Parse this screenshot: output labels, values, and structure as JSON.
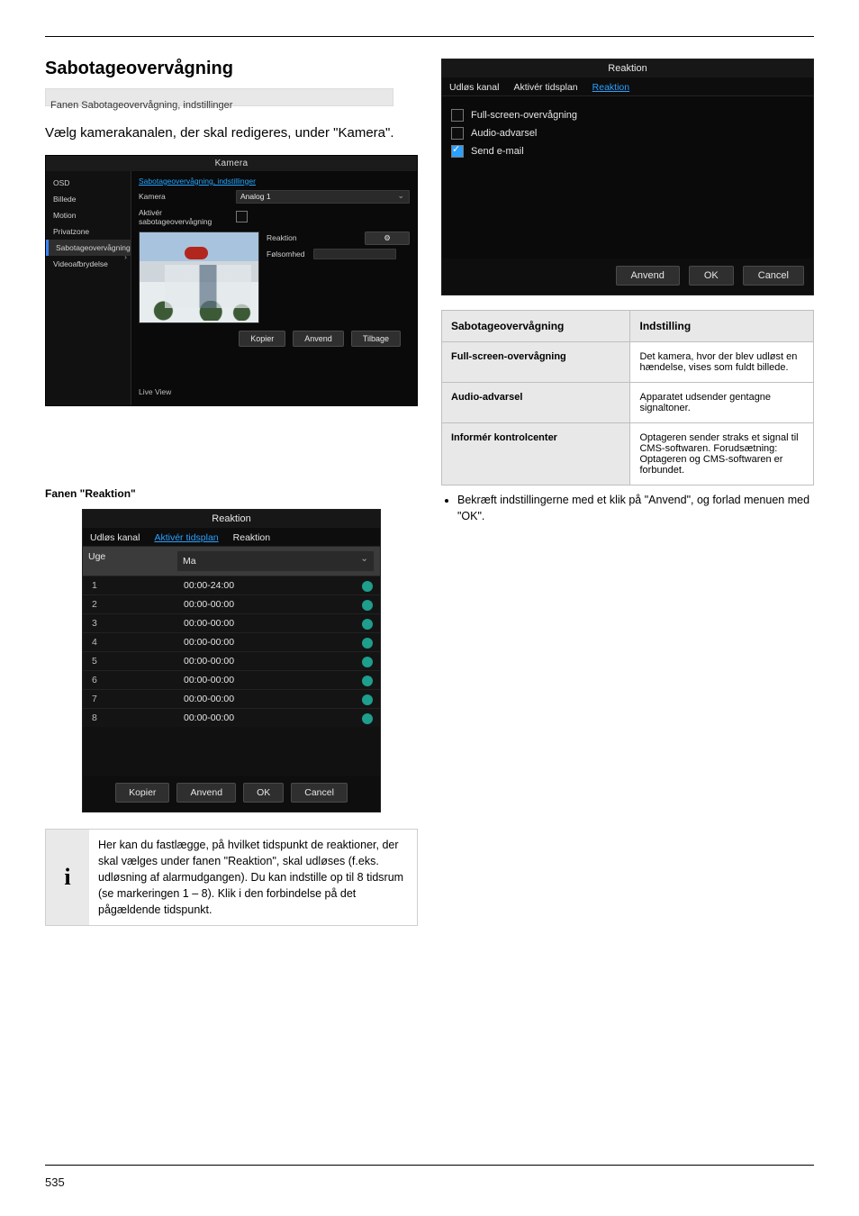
{
  "pageno": "535",
  "left": {
    "heading": "Sabotageovervågning",
    "fanen": "Fanen Sabotageovervågning, indstillinger",
    "intro": "Vælg kamerakanalen, der skal redigeres, under \"Kamera\".",
    "panel1": {
      "title": "Kamera",
      "side": [
        "OSD",
        "Billede",
        "Motion",
        "Privatzone",
        "Sabotageovervågning",
        "Videoafbrydelse"
      ],
      "link": "Sabotageovervågning, indstillinger",
      "row_cam_label": "Kamera",
      "row_cam_value": "Analog 1",
      "row_enable_label": "Aktivér sabotageovervågning",
      "r_reaction": "Reaktion",
      "r_sensitivity": "Følsomhed",
      "r_btn": "⚙",
      "foot": {
        "live": "Live View",
        "copy": "Kopier",
        "apply": "Anvend",
        "back": "Tilbage"
      }
    },
    "caption2": "Fanen \"Reaktion\"",
    "panel2": {
      "title": "Reaktion",
      "tabs": [
        "Udløs kanal",
        "Aktivér tidsplan",
        "Reaktion"
      ],
      "hdrA": "Uge",
      "selDay": "Ma",
      "rows": [
        {
          "n": "1",
          "t": "00:00-24:00"
        },
        {
          "n": "2",
          "t": "00:00-00:00"
        },
        {
          "n": "3",
          "t": "00:00-00:00"
        },
        {
          "n": "4",
          "t": "00:00-00:00"
        },
        {
          "n": "5",
          "t": "00:00-00:00"
        },
        {
          "n": "6",
          "t": "00:00-00:00"
        },
        {
          "n": "7",
          "t": "00:00-00:00"
        },
        {
          "n": "8",
          "t": "00:00-00:00"
        }
      ],
      "foot": {
        "copy": "Kopier",
        "apply": "Anvend",
        "ok": "OK",
        "cancel": "Cancel"
      }
    },
    "info_icon": "i",
    "info": "Her kan du fastlægge, på hvilket tidspunkt de reaktioner, der skal vælges under fanen \"Reaktion\", skal udløses (f.eks. udløsning af alarmudgangen). Du kan indstille op til 8 tidsrum (se markeringen 1 – 8). Klik i den forbindelse på det pågældende tidspunkt."
  },
  "right": {
    "panel3": {
      "title": "Reaktion",
      "tabs": [
        "Udløs kanal",
        "Aktivér tidsplan",
        "Reaktion"
      ],
      "opts": [
        {
          "label": "Full-screen-overvågning",
          "on": false
        },
        {
          "label": "Audio-advarsel",
          "on": false
        },
        {
          "label": "Send e-mail",
          "on": true
        }
      ],
      "foot": {
        "apply": "Anvend",
        "ok": "OK",
        "cancel": "Cancel"
      }
    },
    "table": {
      "h1": "Sabotageovervågning",
      "h2": "Indstilling",
      "r1a": "Full-screen-overvågning",
      "r1b": "Det kamera, hvor der blev udløst en hændelse, vises som fuldt billede.",
      "r2a": "Audio-advarsel",
      "r2b": "Apparatet udsender gentagne signaltoner.",
      "r3a": "Informér kontrolcenter",
      "r3b": "Optageren sender straks et signal til CMS-softwaren. Forudsætning: Optageren og CMS-softwaren er forbundet."
    },
    "bullet": "Bekræft indstillingerne med et klik på \"Anvend\", og forlad menuen med \"OK\"."
  }
}
